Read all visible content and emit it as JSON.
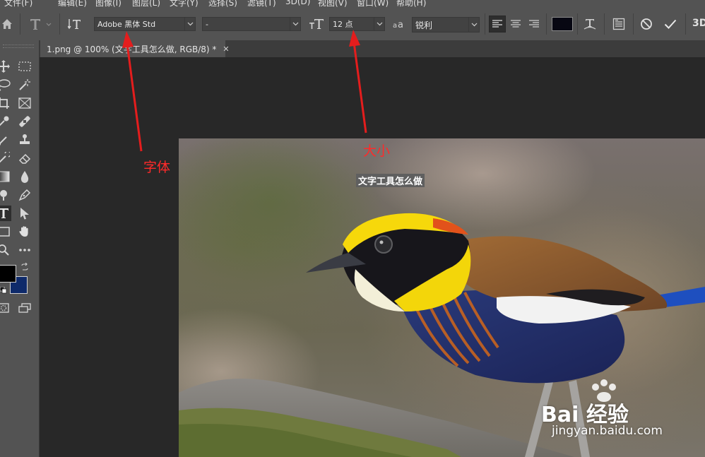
{
  "menu": {
    "items": [
      "文件(F)",
      "编辑(E)",
      "图像(I)",
      "图层(L)",
      "文字(Y)",
      "选择(S)",
      "滤镜(T)",
      "3D(D)",
      "视图(V)",
      "窗口(W)",
      "帮助(H)"
    ]
  },
  "options": {
    "font_family": "Adobe 黑体 Std",
    "font_style": "-",
    "font_size": "12 点",
    "antialias": "锐利",
    "text_color": "#070712",
    "mode_3d": "3D"
  },
  "document": {
    "tab_title": "1.png @ 100% (文字工具怎么做, RGB/8) *"
  },
  "canvas": {
    "text_layer": "文字工具怎么做"
  },
  "colors": {
    "foreground": "#000000",
    "background": "#0e2a6a"
  },
  "annotations": {
    "font_label": "字体",
    "size_label": "大小"
  },
  "watermark": {
    "brand": "Bai 经验",
    "url": "jingyan.baidu.com"
  }
}
